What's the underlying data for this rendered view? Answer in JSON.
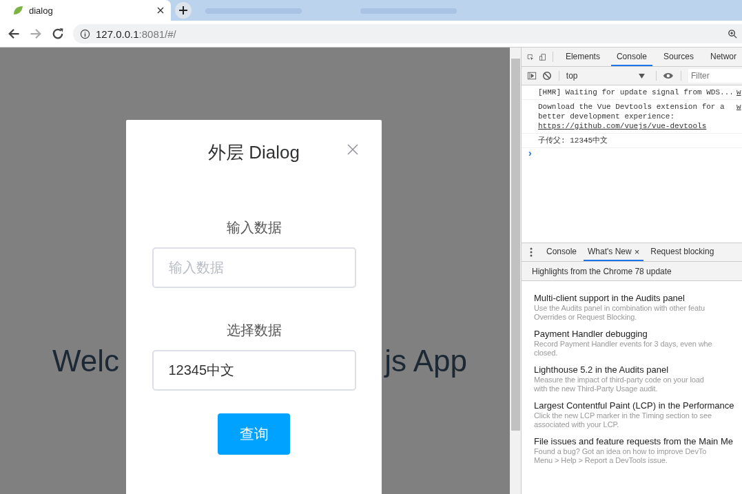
{
  "browser": {
    "tabs": [
      {
        "title": "dialog",
        "selected": true
      },
      {
        "selected": false
      },
      {
        "selected": false
      }
    ],
    "url_host": "127.0.0.1",
    "url_rest": ":8081/#/"
  },
  "page": {
    "welcome_left": "Welc",
    "welcome_right": "js App"
  },
  "dialog": {
    "title": "外层 Dialog",
    "fields": [
      {
        "label": "输入数据",
        "placeholder": "输入数据"
      },
      {
        "label": "选择数据",
        "value": "12345中文"
      }
    ],
    "button": "查询"
  },
  "devtools": {
    "tabs": [
      {
        "label": "Elements",
        "selected": false
      },
      {
        "label": "Console",
        "selected": true
      },
      {
        "label": "Sources",
        "selected": false
      },
      {
        "label": "Networ",
        "selected": false
      }
    ],
    "context": "top",
    "filter_placeholder": "Filter",
    "messages": [
      {
        "lines": [
          "[HMR] Waiting for update signal from WDS..."
        ],
        "source": "w"
      },
      {
        "lines": [
          "Download the Vue Devtools extension for a",
          "better development experience:"
        ],
        "link": "https://github.com/vuejs/vue-devtools",
        "source": "w"
      },
      {
        "lines": [
          "子传父: 12345中文"
        ]
      }
    ],
    "prompt": "›",
    "drawer_tabs": [
      {
        "label": "Console",
        "selected": false,
        "closable": false
      },
      {
        "label": "What's New",
        "selected": true,
        "closable": true
      },
      {
        "label": "Request blocking",
        "selected": false,
        "closable": false
      }
    ],
    "close_glyph": "×",
    "highlights_title": "Highlights from the Chrome 78 update",
    "news": [
      {
        "title": "Multi-client support in the Audits panel",
        "body": [
          "Use the Audits panel in combination with other featu",
          "Overrides or Request Blocking."
        ]
      },
      {
        "title": "Payment Handler debugging",
        "body": [
          "Record Payment Handler events for 3 days, even whe",
          "closed."
        ]
      },
      {
        "title": "Lighthouse 5.2 in the Audits panel",
        "body": [
          "Measure the impact of third-party code on your load",
          "with the new Third-Party Usage audit."
        ]
      },
      {
        "title": "Largest Contentful Paint (LCP) in the Performance",
        "body": [
          "Click the new LCP marker in the Timing section to see",
          "associated with your LCP."
        ]
      },
      {
        "title": "File issues and feature requests from the Main Me",
        "body": [
          "Found a bug? Got an idea on how to improve DevTo",
          "Menu > Help > Report a DevTools issue."
        ]
      }
    ]
  }
}
